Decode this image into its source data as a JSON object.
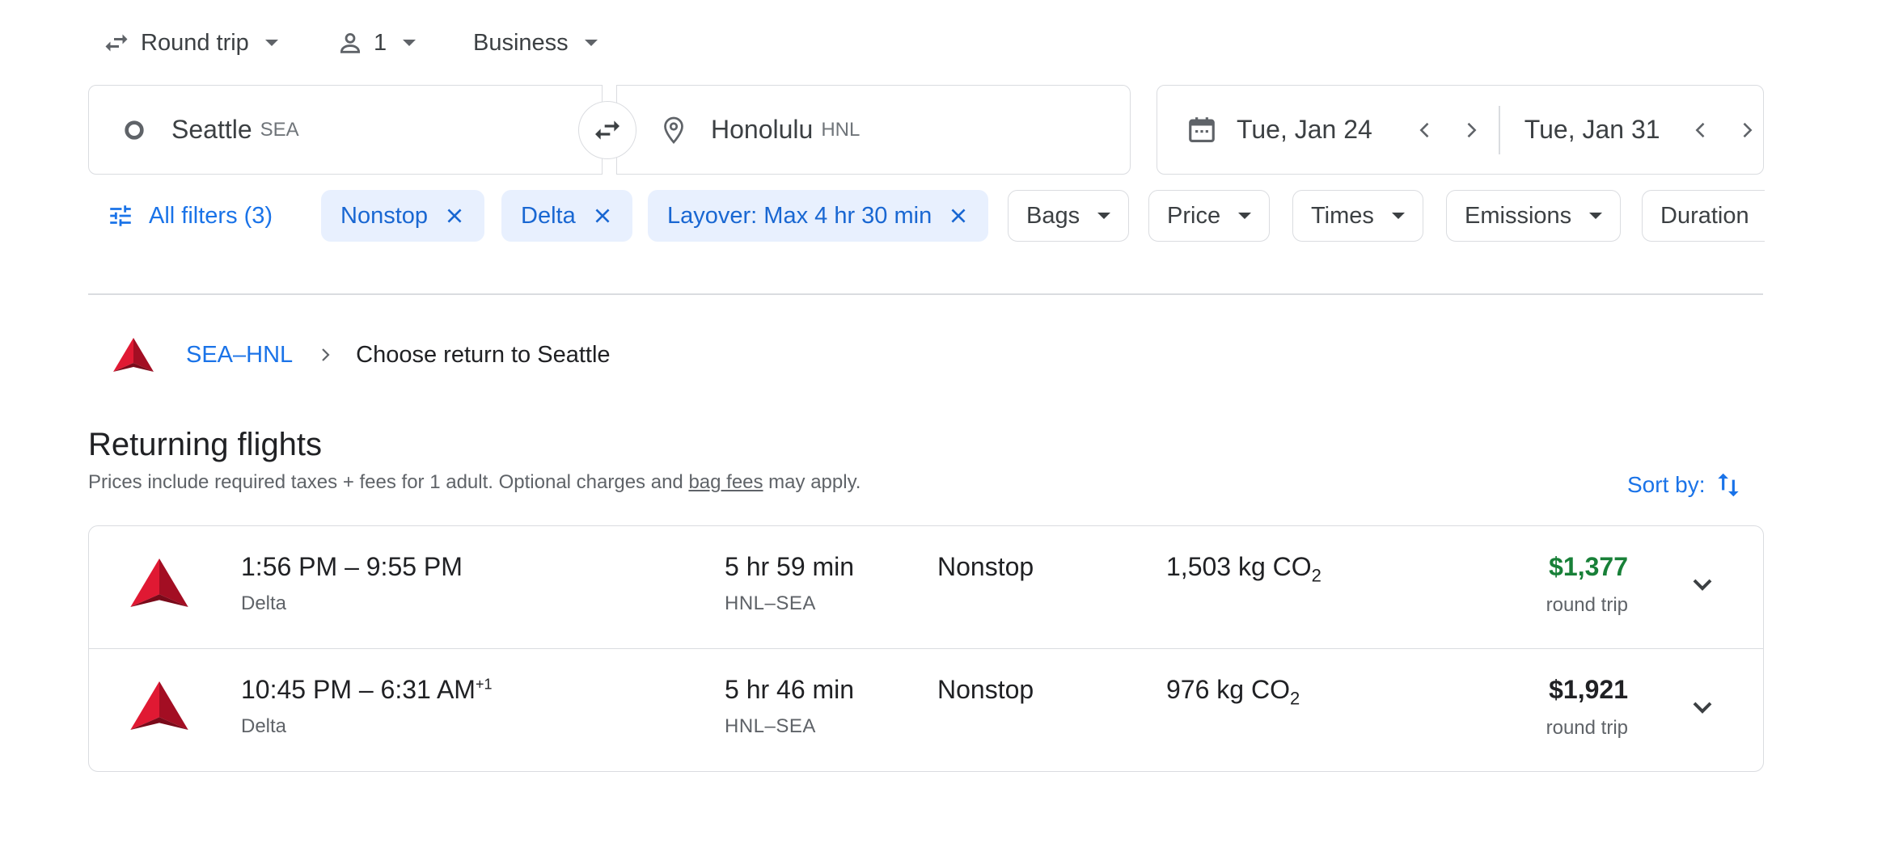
{
  "search": {
    "trip_type": "Round trip",
    "passengers": "1",
    "cabin_class": "Business",
    "origin": {
      "city": "Seattle",
      "code": "SEA"
    },
    "destination": {
      "city": "Honolulu",
      "code": "HNL"
    },
    "depart_date": "Tue, Jan 24",
    "return_date": "Tue, Jan 31"
  },
  "filters": {
    "all_filters_label": "All filters (3)",
    "active": [
      "Nonstop",
      "Delta",
      "Layover: Max 4 hr 30 min"
    ],
    "dropdowns": [
      "Bags",
      "Price",
      "Times",
      "Emissions",
      "Duration"
    ]
  },
  "breadcrumb": {
    "route_link": "SEA–HNL",
    "current": "Choose return to Seattle"
  },
  "results": {
    "heading": "Returning flights",
    "note_prefix": "Prices include required taxes + fees for 1 adult. Optional charges and ",
    "note_link": "bag fees",
    "note_suffix": " may apply.",
    "sort_label": "Sort by:",
    "flights": [
      {
        "times": "1:56 PM – 9:55 PM",
        "day_offset": "",
        "airline": "Delta",
        "duration": "5 hr 59 min",
        "route": "HNL–SEA",
        "stops": "Nonstop",
        "emissions": "1,503 kg CO",
        "emissions_sub": "2",
        "price": "$1,377",
        "price_color": "#188038",
        "price_note": "round trip"
      },
      {
        "times": "10:45 PM – 6:31 AM",
        "day_offset": "+1",
        "airline": "Delta",
        "duration": "5 hr 46 min",
        "route": "HNL–SEA",
        "stops": "Nonstop",
        "emissions": "976 kg CO",
        "emissions_sub": "2",
        "price": "$1,921",
        "price_color": "#202124",
        "price_note": "round trip"
      }
    ]
  },
  "colors": {
    "accent": "#1a73e8",
    "chip_selected_bg": "#e8f0fe",
    "delta_red": "#d0021b",
    "border": "#dadce0"
  }
}
